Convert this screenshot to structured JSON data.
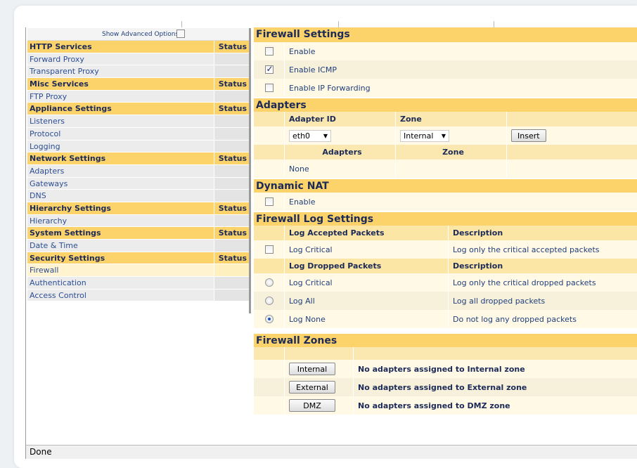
{
  "nav": {
    "advanced_label": "Show Advanced Options",
    "groups": [
      {
        "title": "HTTP Services",
        "status": "Status",
        "items": [
          "Forward Proxy",
          "Transparent Proxy"
        ]
      },
      {
        "title": "Misc Services",
        "status": "Status",
        "items": [
          "FTP Proxy"
        ]
      },
      {
        "title": "Appliance Settings",
        "status": "Status",
        "items": [
          "Listeners",
          "Protocol",
          "Logging"
        ]
      },
      {
        "title": "Network Settings",
        "status": "Status",
        "items": [
          "Adapters",
          "Gateways",
          "DNS"
        ]
      },
      {
        "title": "Hierarchy Settings",
        "status": "Status",
        "items": [
          "Hierarchy"
        ]
      },
      {
        "title": "System Settings",
        "status": "Status",
        "items": [
          "Date & Time"
        ]
      },
      {
        "title": "Security Settings",
        "status": "Status",
        "items": [
          "Firewall",
          "Authentication",
          "Access Control"
        ]
      }
    ],
    "selected_item": "Firewall"
  },
  "firewall_settings": {
    "title": "Firewall Settings",
    "options": [
      {
        "label": "Enable",
        "checked": false
      },
      {
        "label": "Enable ICMP",
        "checked": true
      },
      {
        "label": "Enable IP Forwarding",
        "checked": false
      }
    ]
  },
  "adapters": {
    "title": "Adapters",
    "col_adapter_id": "Adapter ID",
    "col_zone": "Zone",
    "adapter_value": "eth0",
    "zone_value": "Internal",
    "insert_label": "Insert",
    "list_col_adapters": "Adapters",
    "list_col_zone": "Zone",
    "list_empty": "None"
  },
  "dynamic_nat": {
    "title": "Dynamic NAT",
    "enable_label": "Enable",
    "checked": false
  },
  "log_settings": {
    "title": "Firewall Log Settings",
    "accepted_header": "Log Accepted Packets",
    "accepted_desc_header": "Description",
    "accepted": [
      {
        "label": "Log Critical",
        "desc": "Log only the critical accepted packets",
        "checked": false
      }
    ],
    "dropped_header": "Log Dropped Packets",
    "dropped_desc_header": "Description",
    "dropped": [
      {
        "label": "Log Critical",
        "desc": "Log only the critical dropped packets",
        "selected": false
      },
      {
        "label": "Log All",
        "desc": "Log all dropped packets",
        "selected": false
      },
      {
        "label": "Log None",
        "desc": "Do not log any dropped packets",
        "selected": true
      }
    ]
  },
  "zones": {
    "title": "Firewall Zones",
    "rows": [
      {
        "button": "Internal",
        "text": "No adapters assigned to Internal zone"
      },
      {
        "button": "External",
        "text": "No adapters assigned to External zone"
      },
      {
        "button": "DMZ",
        "text": "No adapters assigned to DMZ zone"
      }
    ]
  },
  "status_bar": {
    "text": "Done"
  }
}
